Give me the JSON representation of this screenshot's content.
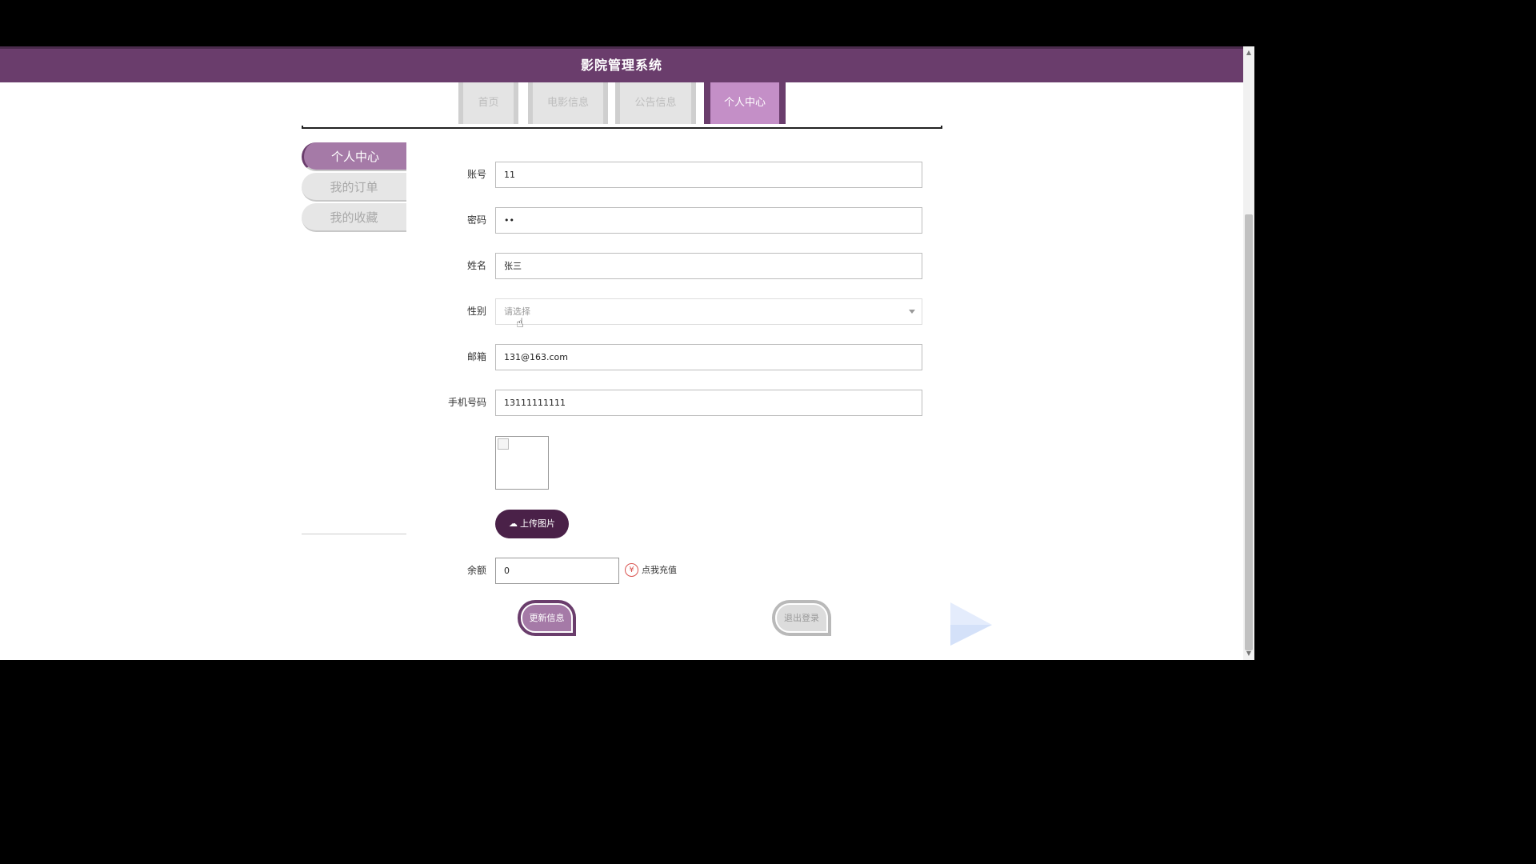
{
  "header": {
    "title": "影院管理系统"
  },
  "nav": {
    "tabs": [
      {
        "label": "首页",
        "active": false
      },
      {
        "label": "电影信息",
        "active": false
      },
      {
        "label": "公告信息",
        "active": false
      },
      {
        "label": "个人中心",
        "active": true
      }
    ]
  },
  "sidebar": {
    "items": [
      {
        "label": "个人中心",
        "active": true
      },
      {
        "label": "我的订单",
        "active": false
      },
      {
        "label": "我的收藏",
        "active": false
      }
    ]
  },
  "form": {
    "account": {
      "label": "账号",
      "value": "11"
    },
    "password": {
      "label": "密码",
      "value": "••"
    },
    "name": {
      "label": "姓名",
      "value": "张三"
    },
    "gender": {
      "label": "性别",
      "placeholder": "请选择"
    },
    "email": {
      "label": "邮箱",
      "value": "131@163.com"
    },
    "phone": {
      "label": "手机号码",
      "value": "13111111111"
    },
    "upload_label": "上传图片",
    "balance": {
      "label": "余额",
      "value": "0"
    },
    "recharge_icon": "¥",
    "recharge_label": "点我充值",
    "update_label": "更新信息",
    "logout_label": "退出登录"
  },
  "colors": {
    "primary": "#6a3d6c",
    "tab_active": "#c48fc7",
    "sidebar_active": "#a57aa7",
    "upload_button": "#4a2148",
    "recharge": "#d9534f"
  },
  "icons": {
    "upload": "cloud-upload-icon",
    "recharge": "yen-circle-icon",
    "select": "caret-down-icon",
    "cursor": "hand-pointer-icon"
  }
}
